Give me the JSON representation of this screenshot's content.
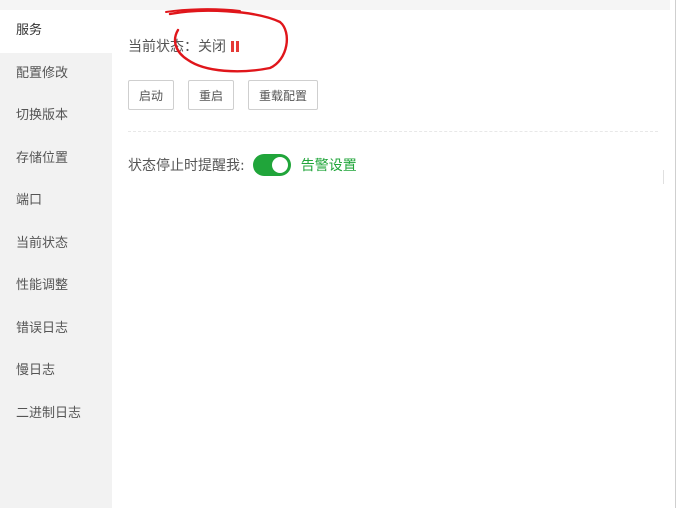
{
  "sidebar": {
    "items": [
      {
        "label": "服务",
        "active": true
      },
      {
        "label": "配置修改"
      },
      {
        "label": "切换版本"
      },
      {
        "label": "存储位置"
      },
      {
        "label": "端口"
      },
      {
        "label": "当前状态"
      },
      {
        "label": "性能调整"
      },
      {
        "label": "错误日志"
      },
      {
        "label": "慢日志"
      },
      {
        "label": "二进制日志"
      }
    ]
  },
  "service": {
    "status_label": "当前状态：",
    "status_value": "关闭",
    "status_icon": "pause-icon",
    "status_color": "#e53935"
  },
  "toolbar": {
    "start_label": "启动",
    "restart_label": "重启",
    "reload_label": "重载配置"
  },
  "alert": {
    "label": "状态停止时提醒我:",
    "toggle_on": true,
    "link_label": "告警设置",
    "accent_color": "#20a53a"
  }
}
